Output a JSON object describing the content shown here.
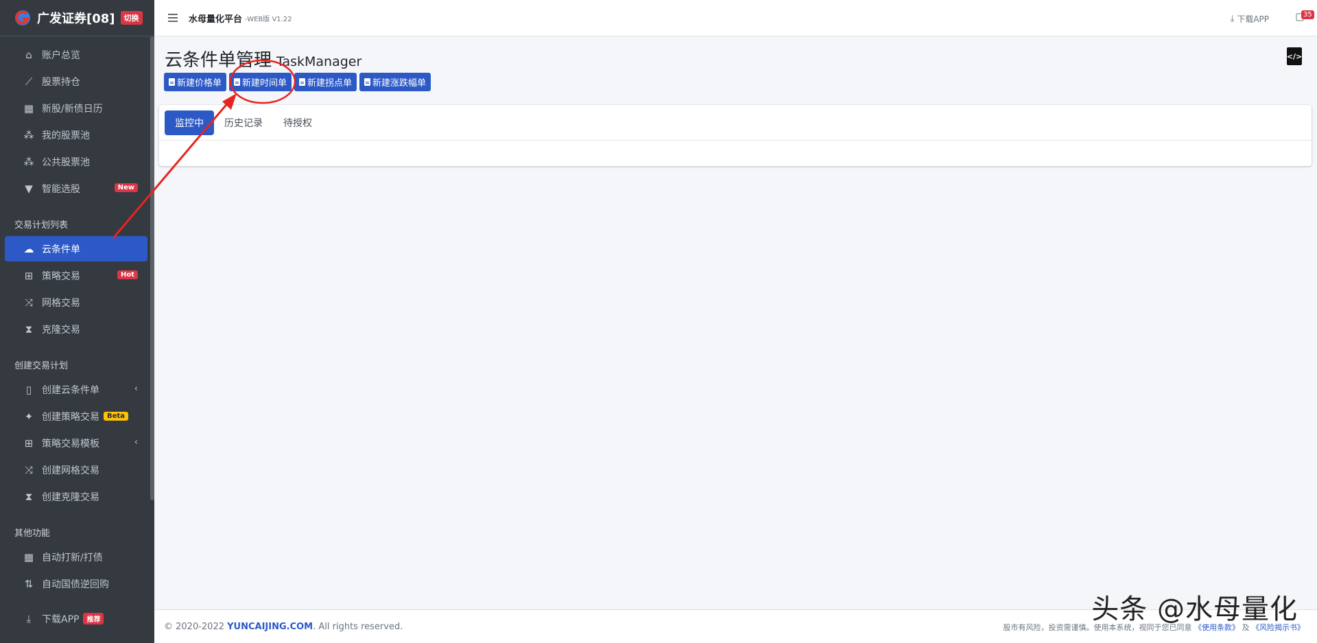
{
  "brand": {
    "name": "广发证券[08]",
    "switch_label": "切换"
  },
  "sidebar": {
    "items_top": [
      {
        "label": "账户总览",
        "icon": "home-icon"
      },
      {
        "label": "股票持仓",
        "icon": "chart-line-icon"
      },
      {
        "label": "新股/新债日历",
        "icon": "calendar-icon"
      },
      {
        "label": "我的股票池",
        "icon": "cubes-icon"
      },
      {
        "label": "公共股票池",
        "icon": "cubes-icon"
      },
      {
        "label": "智能选股",
        "icon": "filter-icon",
        "badge": "New"
      }
    ],
    "section_plan_list": "交易计划列表",
    "items_plan": [
      {
        "label": "云条件单",
        "icon": "cloud-icon",
        "active": true
      },
      {
        "label": "策略交易",
        "icon": "sitemap-icon",
        "badge": "Hot"
      },
      {
        "label": "网格交易",
        "icon": "random-icon"
      },
      {
        "label": "克隆交易",
        "icon": "hourglass-icon"
      }
    ],
    "section_create": "创建交易计划",
    "items_create": [
      {
        "label": "创建云条件单",
        "icon": "file-icon",
        "chevron": "‹"
      },
      {
        "label": "创建策略交易",
        "icon": "magic-icon",
        "badge": "Beta"
      },
      {
        "label": "策略交易模板",
        "icon": "sitemap-icon",
        "chevron": "‹"
      },
      {
        "label": "创建网格交易",
        "icon": "random-icon"
      },
      {
        "label": "创建克隆交易",
        "icon": "hourglass-icon"
      }
    ],
    "section_other": "其他功能",
    "items_other": [
      {
        "label": "自动打新/打债",
        "icon": "calendar-icon"
      },
      {
        "label": "自动国债逆回购",
        "icon": "sort-icon"
      }
    ],
    "download": {
      "label": "下载APP",
      "badge": "推荐"
    }
  },
  "topbar": {
    "title": "水母量化平台",
    "version": "-WEB版 V1.22",
    "download_label": "下载APP",
    "notification_count": "35"
  },
  "main": {
    "title": "云条件单管理",
    "subtitle": "TaskManager",
    "actions": [
      "新建价格单",
      "新建时间单",
      "新建拐点单",
      "新建涨跌幅单"
    ],
    "tabs": [
      {
        "label": "监控中",
        "active": true
      },
      {
        "label": "历史记录",
        "active": false
      },
      {
        "label": "待授权",
        "active": false
      }
    ]
  },
  "footer": {
    "copyright_prefix": "© 2020-2022 ",
    "site": "YUNCAIJING.COM",
    "copyright_suffix": ". All rights reserved.",
    "notice": "股市有风险，投资需谨慎。使用本系统，视同于您已同意",
    "terms": "《使用条款》",
    "and": "及",
    "risk": "《风险揭示书》"
  },
  "overlay": {
    "watermark": "头条 @水母量化",
    "annotation_color": "#e8231f"
  },
  "colors": {
    "sidebar_bg": "#343a40",
    "primary": "#2c59c6",
    "danger": "#dc3545"
  }
}
